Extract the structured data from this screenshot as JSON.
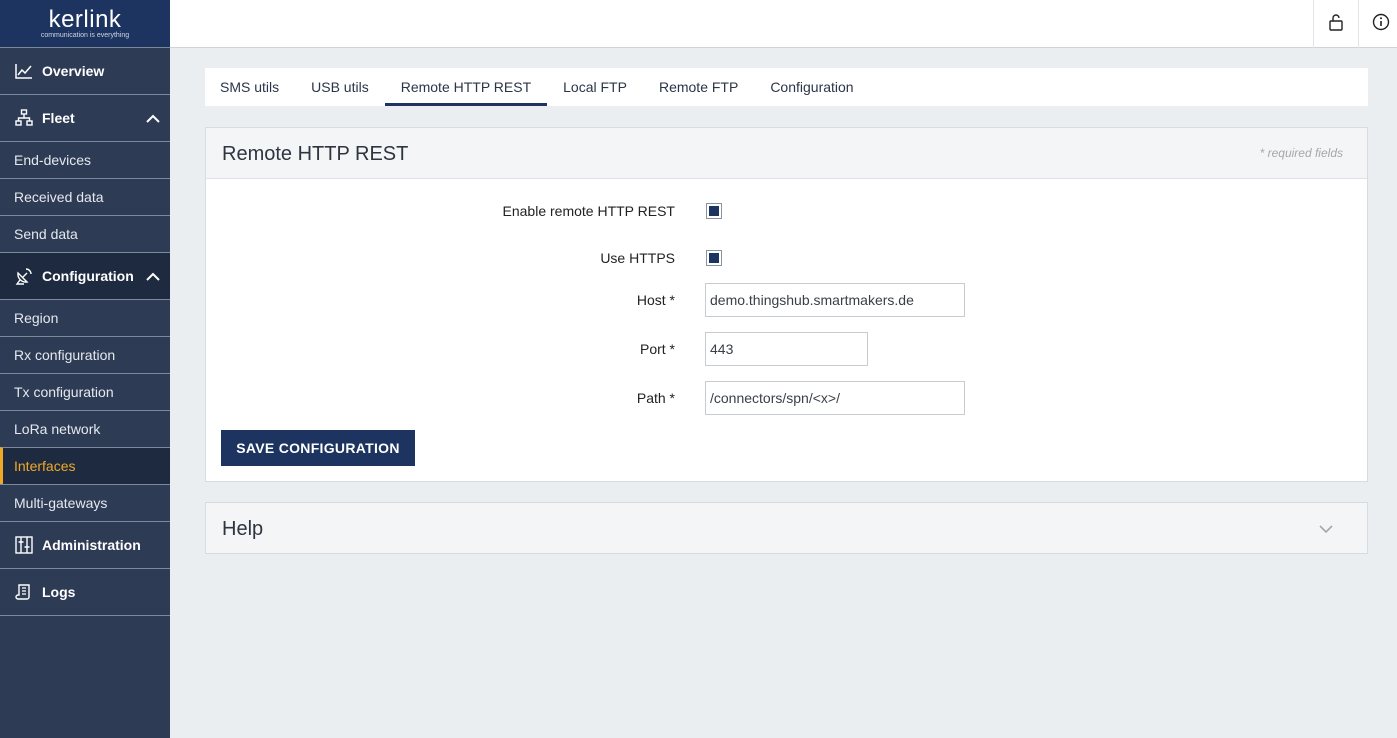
{
  "brand": {
    "name": "kerlink",
    "tagline": "communication is everything"
  },
  "nav": {
    "overview": "Overview",
    "fleet": "Fleet",
    "fleet_items": [
      "End-devices",
      "Received data",
      "Send data"
    ],
    "configuration": "Configuration",
    "config_items": [
      "Region",
      "Rx configuration",
      "Tx configuration",
      "LoRa network",
      "Interfaces",
      "Multi-gateways"
    ],
    "administration": "Administration",
    "logs": "Logs",
    "active_item": "Interfaces"
  },
  "topbar": {
    "icons": [
      "unlock-icon",
      "info-icon"
    ]
  },
  "tabs": [
    "SMS utils",
    "USB utils",
    "Remote HTTP REST",
    "Local FTP",
    "Remote FTP",
    "Configuration"
  ],
  "active_tab": "Remote HTTP REST",
  "panel": {
    "title": "Remote HTTP REST",
    "required_note": "* required fields",
    "enable_label": "Enable remote HTTP REST",
    "enable_checked": true,
    "https_label": "Use HTTPS",
    "https_checked": true,
    "host_label": "Host *",
    "host_value": "demo.thingshub.smartmakers.de",
    "port_label": "Port *",
    "port_value": "443",
    "path_label": "Path *",
    "path_value": "/connectors/spn/<x>/",
    "save_label": "SAVE CONFIGURATION"
  },
  "help": {
    "title": "Help"
  },
  "colors": {
    "primary": "#1d3460",
    "sidebar": "#2e3b54",
    "accent": "#f0a827"
  }
}
